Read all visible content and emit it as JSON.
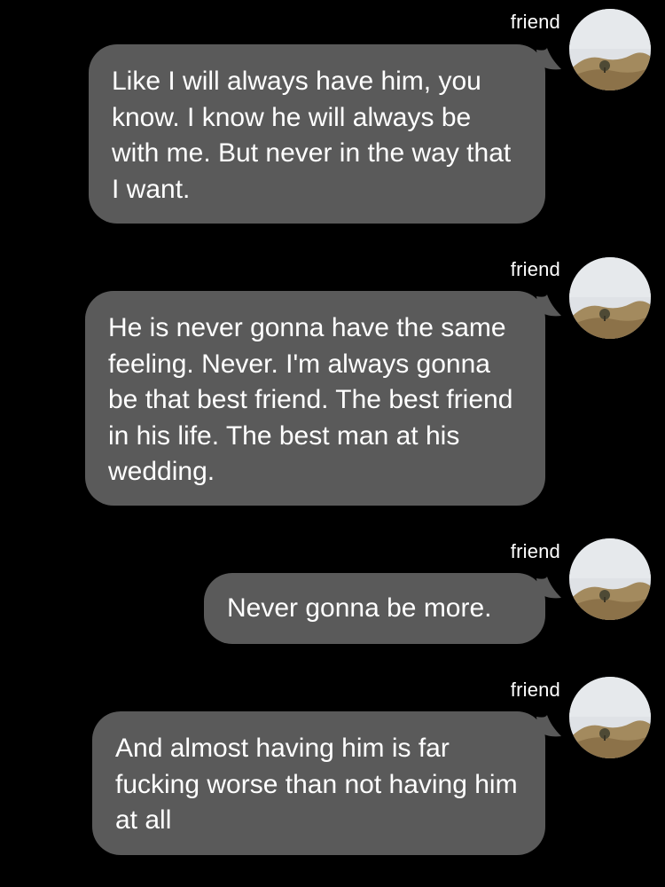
{
  "colors": {
    "background": "#000000",
    "bubble": "#5a5a5a",
    "text": "#ffffff"
  },
  "messages": [
    {
      "sender": "friend",
      "avatar_icon": "hills-landscape-avatar",
      "text": "Like I will always have him, you know. I know he will always be with me. But never in the way that I want."
    },
    {
      "sender": "friend",
      "avatar_icon": "hills-landscape-avatar",
      "text": "He is never gonna have the same feeling. Never. I'm always gonna be that best friend. The best friend in his life. The best man at his wedding."
    },
    {
      "sender": "friend",
      "avatar_icon": "hills-landscape-avatar",
      "text": "Never gonna be more."
    },
    {
      "sender": "friend",
      "avatar_icon": "hills-landscape-avatar",
      "text": "And almost having him is far fucking worse than not having him at all"
    }
  ]
}
